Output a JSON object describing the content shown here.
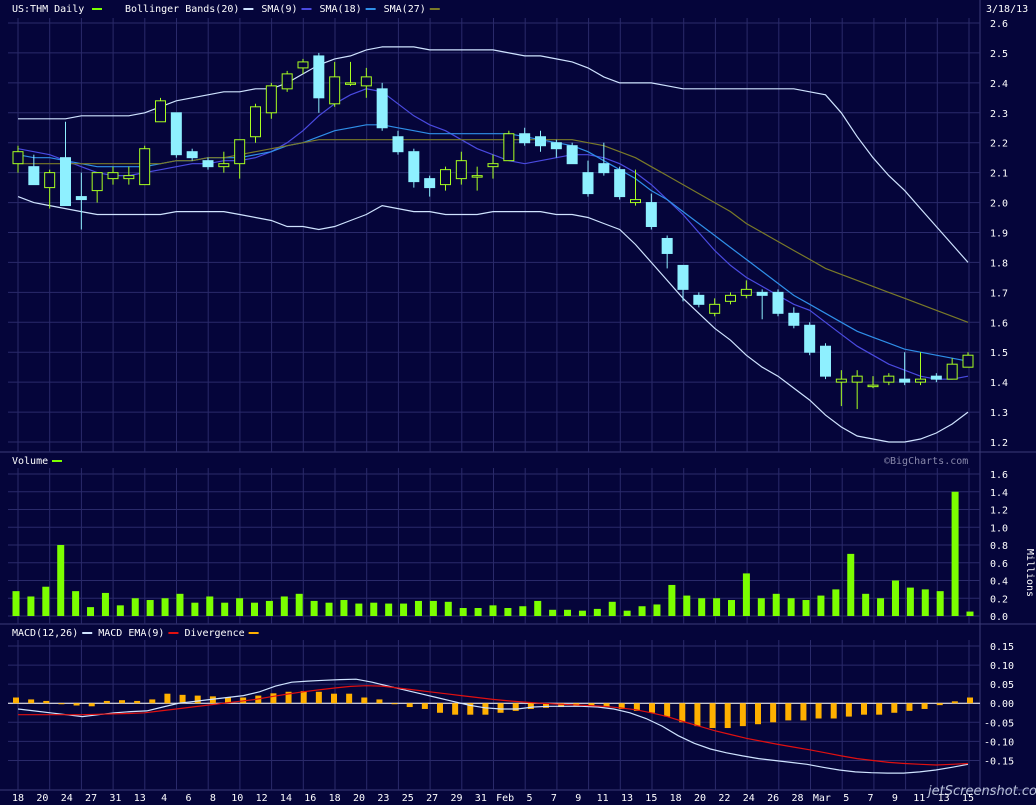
{
  "header": {
    "symbol": "US:THM Daily",
    "date": "3/18/13",
    "legend": [
      {
        "label": "Bollinger Bands(20)",
        "color": "#cfe3ff"
      },
      {
        "label": "SMA(9)",
        "color": "#4a4ae0"
      },
      {
        "label": "SMA(18)",
        "color": "#2f8fe8"
      },
      {
        "label": "SMA(27)",
        "color": "#7a7a28"
      }
    ],
    "symbol_color": "#7cff00"
  },
  "volume_panel": {
    "title": "Volume",
    "title_color": "#7cff00",
    "watermark": "©BigCharts.com",
    "unit_label": "Millions"
  },
  "macd_panel": {
    "legend": [
      {
        "label": "MACD(12,26)",
        "color": "#cfe3ff"
      },
      {
        "label": "MACD EMA(9)",
        "color": "#e01010"
      },
      {
        "label": "Divergence",
        "color": "#ffb000"
      }
    ]
  },
  "footer": {
    "watermark": "jetScreenshot.com"
  },
  "chart_data": [
    {
      "type": "candlestick",
      "panel": "price",
      "ylim": [
        1.2,
        2.6
      ],
      "yticks": [
        "1.2",
        "1.3",
        "1.4",
        "1.5",
        "1.6",
        "1.7",
        "1.8",
        "1.9",
        "2.0",
        "2.1",
        "2.2",
        "2.3",
        "2.4",
        "2.5",
        "2.6"
      ],
      "candles": [
        {
          "o": 2.13,
          "h": 2.19,
          "l": 2.1,
          "c": 2.17
        },
        {
          "o": 2.12,
          "h": 2.16,
          "l": 2.06,
          "c": 2.06
        },
        {
          "o": 2.05,
          "h": 2.11,
          "l": 1.98,
          "c": 2.1
        },
        {
          "o": 2.15,
          "h": 2.27,
          "l": 1.99,
          "c": 1.99
        },
        {
          "o": 2.02,
          "h": 2.1,
          "l": 1.91,
          "c": 2.01
        },
        {
          "o": 2.04,
          "h": 2.1,
          "l": 2.0,
          "c": 2.1
        },
        {
          "o": 2.08,
          "h": 2.12,
          "l": 2.06,
          "c": 2.1
        },
        {
          "o": 2.08,
          "h": 2.12,
          "l": 2.06,
          "c": 2.09
        },
        {
          "o": 2.06,
          "h": 2.19,
          "l": 2.06,
          "c": 2.18
        },
        {
          "o": 2.27,
          "h": 2.35,
          "l": 2.27,
          "c": 2.34
        },
        {
          "o": 2.3,
          "h": 2.3,
          "l": 2.15,
          "c": 2.16
        },
        {
          "o": 2.17,
          "h": 2.18,
          "l": 2.14,
          "c": 2.15
        },
        {
          "o": 2.14,
          "h": 2.15,
          "l": 2.11,
          "c": 2.12
        },
        {
          "o": 2.12,
          "h": 2.17,
          "l": 2.1,
          "c": 2.13
        },
        {
          "o": 2.13,
          "h": 2.21,
          "l": 2.08,
          "c": 2.21
        },
        {
          "o": 2.22,
          "h": 2.33,
          "l": 2.2,
          "c": 2.32
        },
        {
          "o": 2.3,
          "h": 2.4,
          "l": 2.28,
          "c": 2.39
        },
        {
          "o": 2.38,
          "h": 2.44,
          "l": 2.37,
          "c": 2.43
        },
        {
          "o": 2.45,
          "h": 2.48,
          "l": 2.43,
          "c": 2.47
        },
        {
          "o": 2.49,
          "h": 2.5,
          "l": 2.3,
          "c": 2.35
        },
        {
          "o": 2.33,
          "h": 2.47,
          "l": 2.32,
          "c": 2.42
        },
        {
          "o": 2.4,
          "h": 2.47,
          "l": 2.39,
          "c": 2.4
        },
        {
          "o": 2.39,
          "h": 2.45,
          "l": 2.35,
          "c": 2.42
        },
        {
          "o": 2.38,
          "h": 2.4,
          "l": 2.24,
          "c": 2.25
        },
        {
          "o": 2.22,
          "h": 2.24,
          "l": 2.16,
          "c": 2.17
        },
        {
          "o": 2.17,
          "h": 2.18,
          "l": 2.05,
          "c": 2.07
        },
        {
          "o": 2.08,
          "h": 2.09,
          "l": 2.02,
          "c": 2.05
        },
        {
          "o": 2.06,
          "h": 2.12,
          "l": 2.04,
          "c": 2.11
        },
        {
          "o": 2.08,
          "h": 2.17,
          "l": 2.06,
          "c": 2.14
        },
        {
          "o": 2.09,
          "h": 2.12,
          "l": 2.04,
          "c": 2.09
        },
        {
          "o": 2.12,
          "h": 2.16,
          "l": 2.08,
          "c": 2.13
        },
        {
          "o": 2.14,
          "h": 2.24,
          "l": 2.14,
          "c": 2.23
        },
        {
          "o": 2.23,
          "h": 2.25,
          "l": 2.19,
          "c": 2.2
        },
        {
          "o": 2.22,
          "h": 2.24,
          "l": 2.17,
          "c": 2.19
        },
        {
          "o": 2.2,
          "h": 2.21,
          "l": 2.15,
          "c": 2.18
        },
        {
          "o": 2.19,
          "h": 2.2,
          "l": 2.13,
          "c": 2.13
        },
        {
          "o": 2.1,
          "h": 2.14,
          "l": 2.02,
          "c": 2.03
        },
        {
          "o": 2.13,
          "h": 2.2,
          "l": 2.09,
          "c": 2.1
        },
        {
          "o": 2.11,
          "h": 2.12,
          "l": 2.01,
          "c": 2.02
        },
        {
          "o": 2.0,
          "h": 2.11,
          "l": 1.99,
          "c": 2.01
        },
        {
          "o": 2.0,
          "h": 2.03,
          "l": 1.91,
          "c": 1.92
        },
        {
          "o": 1.88,
          "h": 1.89,
          "l": 1.78,
          "c": 1.83
        },
        {
          "o": 1.79,
          "h": 1.79,
          "l": 1.67,
          "c": 1.71
        },
        {
          "o": 1.69,
          "h": 1.7,
          "l": 1.65,
          "c": 1.66
        },
        {
          "o": 1.63,
          "h": 1.68,
          "l": 1.62,
          "c": 1.66
        },
        {
          "o": 1.67,
          "h": 1.7,
          "l": 1.66,
          "c": 1.69
        },
        {
          "o": 1.69,
          "h": 1.74,
          "l": 1.68,
          "c": 1.71
        },
        {
          "o": 1.7,
          "h": 1.71,
          "l": 1.61,
          "c": 1.69
        },
        {
          "o": 1.7,
          "h": 1.71,
          "l": 1.62,
          "c": 1.63
        },
        {
          "o": 1.63,
          "h": 1.65,
          "l": 1.58,
          "c": 1.59
        },
        {
          "o": 1.59,
          "h": 1.6,
          "l": 1.49,
          "c": 1.5
        },
        {
          "o": 1.52,
          "h": 1.53,
          "l": 1.41,
          "c": 1.42
        },
        {
          "o": 1.4,
          "h": 1.44,
          "l": 1.32,
          "c": 1.41
        },
        {
          "o": 1.4,
          "h": 1.44,
          "l": 1.31,
          "c": 1.42
        },
        {
          "o": 1.39,
          "h": 1.42,
          "l": 1.38,
          "c": 1.39
        },
        {
          "o": 1.4,
          "h": 1.43,
          "l": 1.39,
          "c": 1.42
        },
        {
          "o": 1.41,
          "h": 1.5,
          "l": 1.39,
          "c": 1.4
        },
        {
          "o": 1.4,
          "h": 1.5,
          "l": 1.39,
          "c": 1.41
        },
        {
          "o": 1.42,
          "h": 1.43,
          "l": 1.4,
          "c": 1.41
        },
        {
          "o": 1.41,
          "h": 1.48,
          "l": 1.41,
          "c": 1.46
        },
        {
          "o": 1.45,
          "h": 1.5,
          "l": 1.45,
          "c": 1.49
        }
      ],
      "overlays": [
        {
          "name": "Bollinger Bands(20) upper",
          "color": "#cfe3ff",
          "values": [
            2.28,
            2.28,
            2.28,
            2.28,
            2.29,
            2.29,
            2.29,
            2.29,
            2.3,
            2.32,
            2.34,
            2.35,
            2.36,
            2.37,
            2.37,
            2.38,
            2.38,
            2.4,
            2.43,
            2.46,
            2.48,
            2.49,
            2.51,
            2.52,
            2.52,
            2.52,
            2.51,
            2.51,
            2.51,
            2.51,
            2.51,
            2.5,
            2.49,
            2.49,
            2.48,
            2.47,
            2.45,
            2.42,
            2.4,
            2.4,
            2.4,
            2.39,
            2.38,
            2.38,
            2.38,
            2.38,
            2.38,
            2.38,
            2.38,
            2.38,
            2.37,
            2.36,
            2.3,
            2.22,
            2.15,
            2.09,
            2.04,
            1.98,
            1.92,
            1.86,
            1.8
          ]
        },
        {
          "name": "Bollinger Bands(20) lower",
          "color": "#cfe3ff",
          "values": [
            2.02,
            2.0,
            1.99,
            1.98,
            1.97,
            1.96,
            1.96,
            1.96,
            1.96,
            1.96,
            1.97,
            1.97,
            1.97,
            1.97,
            1.96,
            1.95,
            1.94,
            1.92,
            1.92,
            1.91,
            1.92,
            1.94,
            1.96,
            1.99,
            1.98,
            1.97,
            1.97,
            1.96,
            1.96,
            1.96,
            1.97,
            1.97,
            1.97,
            1.97,
            1.96,
            1.96,
            1.95,
            1.93,
            1.91,
            1.86,
            1.8,
            1.74,
            1.68,
            1.63,
            1.58,
            1.54,
            1.49,
            1.45,
            1.42,
            1.38,
            1.34,
            1.29,
            1.25,
            1.22,
            1.21,
            1.2,
            1.2,
            1.21,
            1.23,
            1.26,
            1.3
          ]
        },
        {
          "name": "SMA(9)",
          "color": "#4a4ae0",
          "values": [
            2.18,
            2.17,
            2.16,
            2.14,
            2.12,
            2.1,
            2.09,
            2.09,
            2.1,
            2.11,
            2.12,
            2.13,
            2.13,
            2.14,
            2.14,
            2.15,
            2.17,
            2.2,
            2.24,
            2.29,
            2.33,
            2.36,
            2.38,
            2.37,
            2.33,
            2.29,
            2.26,
            2.24,
            2.21,
            2.18,
            2.16,
            2.14,
            2.13,
            2.14,
            2.15,
            2.16,
            2.16,
            2.15,
            2.13,
            2.1,
            2.06,
            2.01,
            1.96,
            1.9,
            1.84,
            1.79,
            1.75,
            1.72,
            1.69,
            1.66,
            1.64,
            1.6,
            1.56,
            1.52,
            1.49,
            1.46,
            1.44,
            1.42,
            1.41,
            1.41,
            1.42
          ]
        },
        {
          "name": "SMA(18)",
          "color": "#2f8fe8",
          "values": [
            2.16,
            2.15,
            2.15,
            2.14,
            2.13,
            2.12,
            2.12,
            2.12,
            2.12,
            2.13,
            2.14,
            2.14,
            2.15,
            2.15,
            2.15,
            2.16,
            2.17,
            2.19,
            2.2,
            2.22,
            2.24,
            2.25,
            2.26,
            2.26,
            2.25,
            2.24,
            2.23,
            2.23,
            2.23,
            2.23,
            2.23,
            2.23,
            2.22,
            2.21,
            2.2,
            2.19,
            2.17,
            2.14,
            2.11,
            2.08,
            2.04,
            2.01,
            1.97,
            1.93,
            1.89,
            1.85,
            1.81,
            1.77,
            1.73,
            1.69,
            1.66,
            1.63,
            1.6,
            1.57,
            1.55,
            1.53,
            1.51,
            1.5,
            1.49,
            1.48,
            1.47
          ]
        },
        {
          "name": "SMA(27)",
          "color": "#7a7a28",
          "values": [
            2.13,
            2.13,
            2.13,
            2.13,
            2.13,
            2.13,
            2.13,
            2.13,
            2.13,
            2.13,
            2.14,
            2.14,
            2.15,
            2.15,
            2.16,
            2.17,
            2.18,
            2.19,
            2.2,
            2.21,
            2.21,
            2.21,
            2.21,
            2.21,
            2.21,
            2.21,
            2.21,
            2.21,
            2.21,
            2.21,
            2.21,
            2.21,
            2.21,
            2.21,
            2.21,
            2.21,
            2.2,
            2.19,
            2.17,
            2.15,
            2.12,
            2.09,
            2.06,
            2.03,
            2.0,
            1.97,
            1.93,
            1.9,
            1.87,
            1.84,
            1.81,
            1.78,
            1.76,
            1.74,
            1.72,
            1.7,
            1.68,
            1.66,
            1.64,
            1.62,
            1.6
          ]
        }
      ]
    },
    {
      "type": "bar",
      "panel": "volume",
      "ylim": [
        0,
        1.6
      ],
      "yticks": [
        "0.0",
        "0.2",
        "0.4",
        "0.6",
        "0.8",
        "1.0",
        "1.2",
        "1.4",
        "1.6"
      ],
      "ylabel": "Millions",
      "values": [
        0.28,
        0.22,
        0.33,
        0.8,
        0.28,
        0.1,
        0.26,
        0.12,
        0.2,
        0.18,
        0.2,
        0.25,
        0.15,
        0.22,
        0.15,
        0.2,
        0.15,
        0.17,
        0.22,
        0.25,
        0.17,
        0.15,
        0.18,
        0.14,
        0.15,
        0.14,
        0.14,
        0.17,
        0.17,
        0.16,
        0.09,
        0.09,
        0.12,
        0.09,
        0.11,
        0.17,
        0.07,
        0.07,
        0.06,
        0.08,
        0.16,
        0.06,
        0.11,
        0.13,
        0.35,
        0.23,
        0.2,
        0.2,
        0.18,
        0.48,
        0.2,
        0.25,
        0.2,
        0.18,
        0.23,
        0.3,
        0.7,
        0.25,
        0.2,
        0.4,
        0.32,
        0.3,
        0.28,
        1.4,
        0.05
      ]
    },
    {
      "type": "line",
      "panel": "macd",
      "ylim": [
        -0.2,
        0.2
      ],
      "yticks": [
        "0.15",
        "0.10",
        "0.05",
        "0.00",
        "-0.05",
        "-0.10",
        "-0.15"
      ],
      "series": [
        {
          "name": "MACD(12,26)",
          "color": "#cfe3ff",
          "values": [
            -0.015,
            -0.02,
            -0.025,
            -0.03,
            -0.035,
            -0.03,
            -0.025,
            -0.022,
            -0.02,
            -0.01,
            0.0,
            0.005,
            0.01,
            0.015,
            0.02,
            0.03,
            0.045,
            0.055,
            0.058,
            0.06,
            0.062,
            0.063,
            0.055,
            0.045,
            0.035,
            0.025,
            0.015,
            0.005,
            -0.005,
            -0.012,
            -0.015,
            -0.015,
            -0.01,
            -0.008,
            -0.008,
            -0.008,
            -0.01,
            -0.015,
            -0.025,
            -0.04,
            -0.06,
            -0.085,
            -0.105,
            -0.12,
            -0.13,
            -0.138,
            -0.145,
            -0.15,
            -0.155,
            -0.16,
            -0.168,
            -0.175,
            -0.18,
            -0.182,
            -0.183,
            -0.183,
            -0.18,
            -0.175,
            -0.168,
            -0.16
          ]
        },
        {
          "name": "MACD EMA(9)",
          "color": "#e01010",
          "values": [
            -0.03,
            -0.03,
            -0.03,
            -0.03,
            -0.03,
            -0.029,
            -0.028,
            -0.027,
            -0.025,
            -0.02,
            -0.015,
            -0.01,
            -0.005,
            0.0,
            0.005,
            0.01,
            0.017,
            0.024,
            0.03,
            0.035,
            0.04,
            0.044,
            0.046,
            0.045,
            0.04,
            0.035,
            0.03,
            0.025,
            0.02,
            0.015,
            0.01,
            0.006,
            0.003,
            0.0,
            -0.002,
            -0.004,
            -0.006,
            -0.008,
            -0.012,
            -0.017,
            -0.025,
            -0.035,
            -0.048,
            -0.06,
            -0.072,
            -0.082,
            -0.092,
            -0.1,
            -0.108,
            -0.115,
            -0.122,
            -0.13,
            -0.138,
            -0.145,
            -0.15,
            -0.155,
            -0.158,
            -0.16,
            -0.162,
            -0.16,
            -0.158
          ]
        }
      ],
      "divergence_bars": [
        0.015,
        0.01,
        0.006,
        0.0,
        -0.006,
        -0.008,
        0.006,
        0.008,
        0.006,
        0.01,
        0.025,
        0.022,
        0.02,
        0.018,
        0.015,
        0.015,
        0.02,
        0.026,
        0.03,
        0.032,
        0.03,
        0.025,
        0.025,
        0.015,
        0.01,
        0.0,
        -0.01,
        -0.015,
        -0.025,
        -0.03,
        -0.03,
        -0.03,
        -0.025,
        -0.02,
        -0.015,
        -0.012,
        -0.01,
        -0.008,
        -0.008,
        -0.01,
        -0.015,
        -0.02,
        -0.025,
        -0.035,
        -0.05,
        -0.06,
        -0.065,
        -0.065,
        -0.06,
        -0.055,
        -0.05,
        -0.045,
        -0.045,
        -0.04,
        -0.04,
        -0.035,
        -0.03,
        -0.03,
        -0.025,
        -0.02,
        -0.015,
        -0.005,
        0.005,
        0.015
      ]
    }
  ],
  "x_axis": {
    "labels": [
      "18",
      "20",
      "24",
      "27",
      "31",
      "13",
      "4",
      "6",
      "8",
      "10",
      "12",
      "14",
      "16",
      "18",
      "20",
      "23",
      "25",
      "27",
      "29",
      "31",
      "Feb",
      "5",
      "7",
      "9",
      "11",
      "13",
      "15",
      "18",
      "20",
      "22",
      "24",
      "26",
      "28",
      "Mar",
      "5",
      "7",
      "9",
      "11",
      "13",
      "15"
    ]
  }
}
